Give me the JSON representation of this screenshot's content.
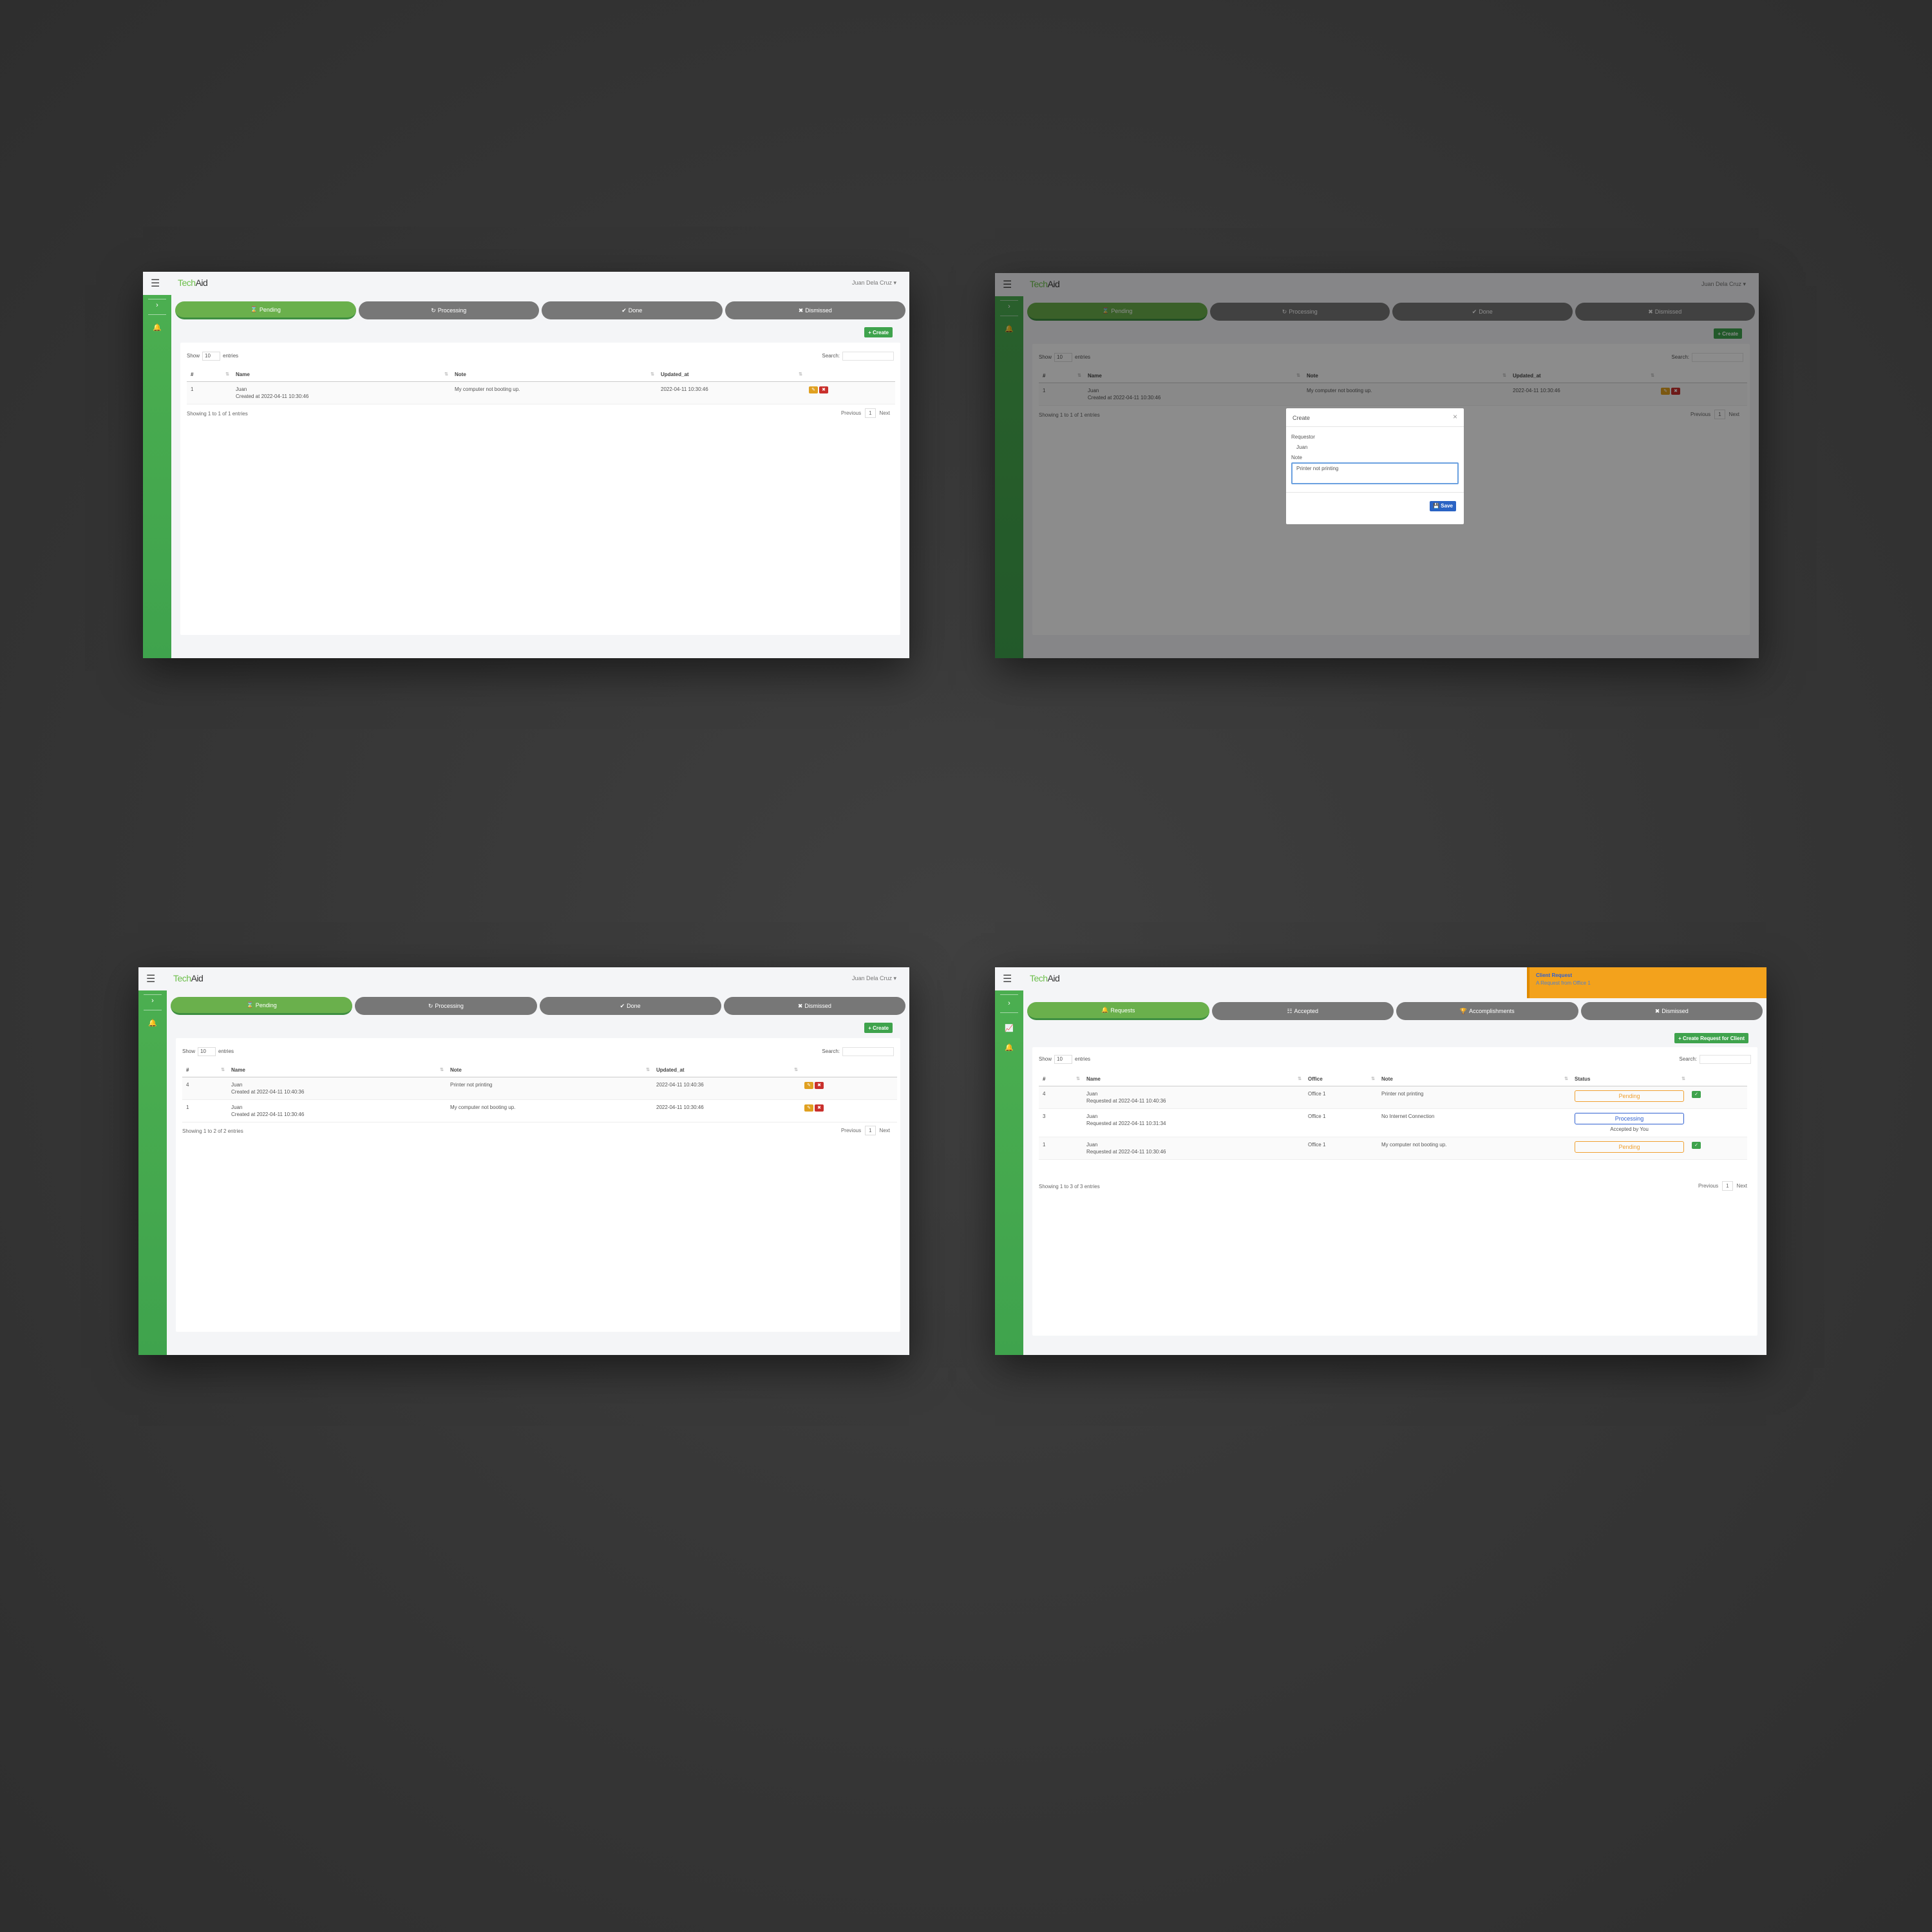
{
  "app": {
    "brand_a": "Tech",
    "brand_b": "Aid",
    "user_name": "Juan Dela Cruz ▾",
    "menu_icon": "☰",
    "arrow_icon": "›",
    "bell_icon": "🔔",
    "chart_icon": "📈"
  },
  "client": {
    "tabs": [
      {
        "icon": "⌛",
        "label": "Pending"
      },
      {
        "icon": "↻",
        "label": "Processing"
      },
      {
        "icon": "✔",
        "label": "Done"
      },
      {
        "icon": "✖",
        "label": "Dismissed"
      }
    ],
    "create_label": "+ Create",
    "show_label": "Show",
    "entries_value": "10",
    "entries_label": "entries",
    "search_label": "Search:",
    "columns": [
      "#",
      "Name",
      "Note",
      "Updated_at"
    ],
    "prev_label": "Previous",
    "page_num": "1",
    "next_label": "Next"
  },
  "shot1": {
    "rows": [
      {
        "num": "1",
        "name": "Juan",
        "sub": "Created at 2022-04-11 10:30:46",
        "note": "My computer not booting up.",
        "updated": "2022-04-11 10:30:46"
      }
    ],
    "info": "Showing 1 to 1 of 1 entries"
  },
  "shot2": {
    "modal_title": "Create",
    "close_icon": "×",
    "requestor_label": "Requestor",
    "requestor_value": "Juan",
    "note_label": "Note",
    "note_value": "Printer not printing",
    "save_label": "💾 Save"
  },
  "shot3": {
    "rows": [
      {
        "num": "4",
        "name": "Juan",
        "sub": "Created at 2022-04-11 10:40:36",
        "note": "Printer not printing",
        "updated": "2022-04-11 10:40:36"
      },
      {
        "num": "1",
        "name": "Juan",
        "sub": "Created at 2022-04-11 10:30:46",
        "note": "My computer not booting up.",
        "updated": "2022-04-11 10:30:46"
      }
    ],
    "info": "Showing 1 to 2 of 2 entries"
  },
  "shot4": {
    "toast_title": "Client Request",
    "toast_body": "A Request from Office 1",
    "tabs": [
      {
        "icon": "🔔",
        "label": "Requests"
      },
      {
        "icon": "☷",
        "label": "Accepted"
      },
      {
        "icon": "🏆",
        "label": "Accomplishments"
      },
      {
        "icon": "✖",
        "label": "Dismissed"
      }
    ],
    "create_label": "+ Create Request for Client",
    "columns": [
      "#",
      "Name",
      "Office",
      "Note",
      "Status"
    ],
    "rows": [
      {
        "num": "4",
        "name": "Juan",
        "sub": "Requested at 2022-04-11 10:40:36",
        "office": "Office 1",
        "note": "Printer not printing",
        "status": "Pending",
        "accepted": ""
      },
      {
        "num": "3",
        "name": "Juan",
        "sub": "Requested at 2022-04-11 10:31:34",
        "office": "Office 1",
        "note": "No Internet Connection",
        "status": "Processing",
        "accepted": "Accepted by You"
      },
      {
        "num": "1",
        "name": "Juan",
        "sub": "Requested at 2022-04-11 10:30:46",
        "office": "Office 1",
        "note": "My computer not booting up.",
        "status": "Pending",
        "accepted": ""
      }
    ],
    "info": "Showing 1 to 3 of 3 entries"
  },
  "colors": {
    "accent_green": "#4caf50",
    "tab_gray": "#777777",
    "pending_orange": "#f0a030",
    "processing_blue": "#3060d0",
    "toast_orange": "#f3a21c"
  }
}
